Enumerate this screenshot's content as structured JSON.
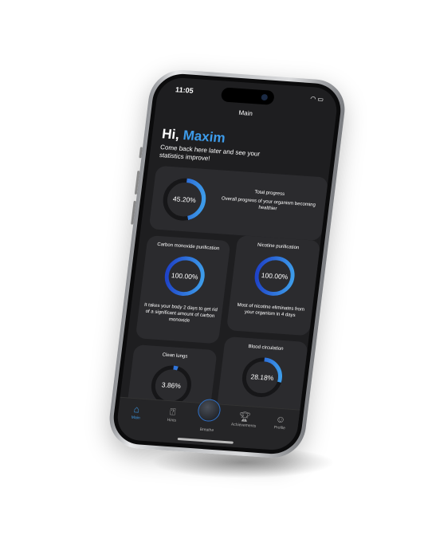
{
  "status_bar": {
    "time": "11:05",
    "icons": [
      "wifi-icon",
      "battery-icon"
    ]
  },
  "header": {
    "title": "Main"
  },
  "greeting": {
    "hi": "Hi,",
    "name": "Maxim",
    "subtitle": "Come back here later and see your statistics improve!"
  },
  "total": {
    "title": "Total progress",
    "description": "Overall progress of your organism becoming healthier",
    "value": "45.20%",
    "progress": 0.452
  },
  "cards": [
    {
      "title": "Carbon monoxide purification",
      "value": "100.00%",
      "progress": 1.0,
      "description": "It takes your body 2 days to get rid of a significant amount of carbon monoxide"
    },
    {
      "title": "Nicotine purification",
      "value": "100.00%",
      "progress": 1.0,
      "description": "Most of nicotine eliminates from your organism in 4 days"
    },
    {
      "title": "Clean lungs",
      "value": "3.86%",
      "progress": 0.0386
    },
    {
      "title": "Blood circulation",
      "value": "28.18%",
      "progress": 0.2818
    }
  ],
  "tabs": [
    {
      "label": "Main",
      "icon": "home-icon"
    },
    {
      "label": "Hints",
      "icon": "hint-icon"
    },
    {
      "label": "Breathe",
      "icon": "breathe-icon"
    },
    {
      "label": "Achievements",
      "icon": "trophy-icon"
    },
    {
      "label": "Profile",
      "icon": "profile-icon"
    }
  ],
  "colors": {
    "accent": "#3d9be9",
    "ring_dark": "#1f44c8",
    "track": "#161618"
  }
}
